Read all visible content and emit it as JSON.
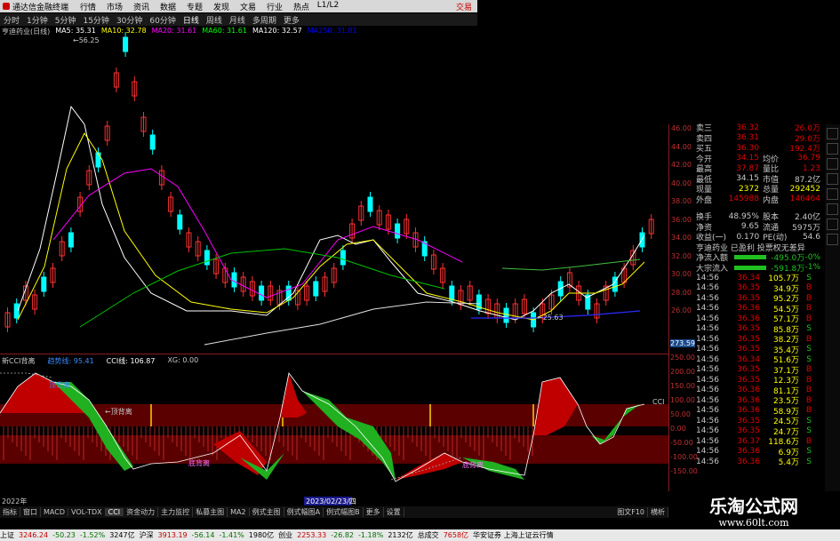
{
  "titlebar": {
    "app": "通达信金融终端",
    "menu": [
      "行情",
      "市场",
      "资讯",
      "数据",
      "专题",
      "发现",
      "文易",
      "行业",
      "热点",
      "L1/L2"
    ],
    "trade": "交易"
  },
  "periods": [
    "分时",
    "1分钟",
    "5分钟",
    "15分钟",
    "30分钟",
    "60分钟",
    "日线",
    "周线",
    "月线",
    "多周期",
    "更多"
  ],
  "selected_period": "日线",
  "ma_legend": [
    {
      "label": "亨迪药业(日线)",
      "color": "#c8c8c8"
    },
    {
      "label": "MA5: 35.31",
      "color": "#ffffff"
    },
    {
      "label": "MA10: 32.78",
      "color": "#ffff00"
    },
    {
      "label": "MA20: 31.61",
      "color": "#ff00ff"
    },
    {
      "label": "MA60: 31.61",
      "color": "#00ff00"
    },
    {
      "label": "MA120: 32.57",
      "color": "#ffffff"
    },
    {
      "label": "MA250: 31.81",
      "color": "#0000ff"
    }
  ],
  "price_high": "56.25",
  "price_low": "25.63",
  "right_axis": [
    "46.00",
    "44.00",
    "42.00",
    "40.00",
    "38.00",
    "36.00",
    "34.00",
    "32.00",
    "30.00",
    "28.00",
    "26.00"
  ],
  "sub_legend": [
    {
      "label": "新CCI背离",
      "color": "#c8c8c8"
    },
    {
      "label": "趋势线: 95.41",
      "color": "#3a8cff"
    },
    {
      "label": "CCI线: 106.87",
      "color": "#ffffff"
    },
    {
      "label": "XG: 0.00",
      "color": "#c8c8c8"
    }
  ],
  "sub_axis": [
    "273.59",
    "250.00",
    "200.00",
    "150.00",
    "100.00",
    "50.00",
    "0.00",
    "-50.00",
    "-100.00",
    "-150.00"
  ],
  "annotations": {
    "top_div": "顶背离",
    "bottom_div": "底背离",
    "top_div2": "顶背离",
    "bottom_div2": "底背离",
    "cci": "CCI"
  },
  "date_labels": [
    "2022年",
    "2023/02/23/四"
  ],
  "quote_panel": [
    {
      "k": "卖三",
      "v": "36.32",
      "v2": "26.0万",
      "c": "#e00000"
    },
    {
      "k": "卖四",
      "v": "36.31",
      "v2": "29.0万",
      "c": "#e00000"
    },
    {
      "k": "买五",
      "v": "36.30",
      "v2": "192.4万",
      "c": "#e00000"
    },
    {
      "k": "今开",
      "v": "34.15",
      "k2": "均价",
      "v2": "36.79",
      "c": "#e00000"
    },
    {
      "k": "最高",
      "v": "37.87",
      "k2": "量比",
      "v2": "1.23",
      "c": "#e00000"
    },
    {
      "k": "最低",
      "v": "34.15",
      "k2": "市值",
      "v2": "87.2亿",
      "c": "#c8c8c8"
    },
    {
      "k": "现量",
      "v": "2372",
      "k2": "总量",
      "v2": "292452",
      "c": "#ffff00"
    },
    {
      "k": "外盘",
      "v": "145988",
      "k2": "内盘",
      "v2": "146464",
      "c": "#e00000"
    }
  ],
  "quote_panel2": [
    {
      "k": "换手",
      "v": "48.95%",
      "k2": "股本",
      "v2": "2.40亿"
    },
    {
      "k": "净资",
      "v": "9.65",
      "k2": "流通",
      "v2": "5975万"
    },
    {
      "k": "收益(一)",
      "v": "0.170",
      "k2": "PE(动)",
      "v2": "54.6"
    }
  ],
  "company_row": "亨迪药业 已盈利 投票权无差异",
  "flows": [
    {
      "k": "净流入额",
      "v": "-495.0万",
      "p": "-0%"
    },
    {
      "k": "大宗流入",
      "v": "-591.8万",
      "p": "-1%"
    }
  ],
  "ticks": [
    {
      "t": "14:56",
      "p": "36.34",
      "v": "105.7万",
      "s": "S"
    },
    {
      "t": "14:56",
      "p": "36.35",
      "v": "34.9万",
      "s": "B"
    },
    {
      "t": "14:56",
      "p": "36.35",
      "v": "95.2万",
      "s": "B"
    },
    {
      "t": "14:56",
      "p": "36.36",
      "v": "54.5万",
      "s": "B"
    },
    {
      "t": "14:56",
      "p": "36.36",
      "v": "57.1万",
      "s": "B"
    },
    {
      "t": "14:56",
      "p": "36.35",
      "v": "85.8万",
      "s": "S"
    },
    {
      "t": "14:56",
      "p": "36.35",
      "v": "38.2万",
      "s": "B"
    },
    {
      "t": "14:56",
      "p": "36.35",
      "v": "35.4万",
      "s": "S"
    },
    {
      "t": "14:56",
      "p": "36.34",
      "v": "51.6万",
      "s": "S"
    },
    {
      "t": "14:56",
      "p": "36.35",
      "v": "37.1万",
      "s": "B"
    },
    {
      "t": "14:56",
      "p": "36.35",
      "v": "12.3万",
      "s": "B"
    },
    {
      "t": "14:56",
      "p": "36.36",
      "v": "81.1万",
      "s": "B"
    },
    {
      "t": "14:56",
      "p": "36.36",
      "v": "23.5万",
      "s": "B"
    },
    {
      "t": "14:56",
      "p": "36.36",
      "v": "58.9万",
      "s": "B"
    },
    {
      "t": "14:56",
      "p": "36.35",
      "v": "24.5万",
      "s": "S"
    },
    {
      "t": "14:56",
      "p": "36.35",
      "v": "24.7万",
      "s": "S"
    },
    {
      "t": "14:56",
      "p": "36.37",
      "v": "118.6万",
      "s": "B"
    },
    {
      "t": "14:56",
      "p": "36.36",
      "v": "6.9万",
      "s": "S"
    },
    {
      "t": "14:56",
      "p": "36.36",
      "v": "5.4万",
      "s": "S"
    }
  ],
  "tabs": [
    "指标",
    "窗口",
    "MACD",
    "VOL-TDX",
    "CCI",
    "资金动力",
    "主力监控",
    "私募主图",
    "MA2",
    "例式主图",
    "例式幅图A",
    "例式幅图B",
    "更多",
    "设置"
  ],
  "tabs_right": [
    "图文F10",
    "横析"
  ],
  "status": [
    {
      "k": "上证",
      "v": "3246.24",
      "d": "-50.23",
      "p": "-1.52%",
      "a": "3247亿"
    },
    {
      "k": "沪深",
      "v": "3913.19",
      "d": "-56.14",
      "p": "-1.41%",
      "a": "1980亿"
    },
    {
      "k": "创业",
      "v": "2253.33",
      "d": "-26.82",
      "p": "-1.18%",
      "a": "2132亿"
    },
    {
      "k": "总成交",
      "v": "7658亿",
      "d": "",
      "p": "",
      "a": ""
    }
  ],
  "status_tail": "华安证券 上海上证云行情",
  "watermark": {
    "title": "乐淘公式网",
    "url": "www.60lt.com"
  }
}
